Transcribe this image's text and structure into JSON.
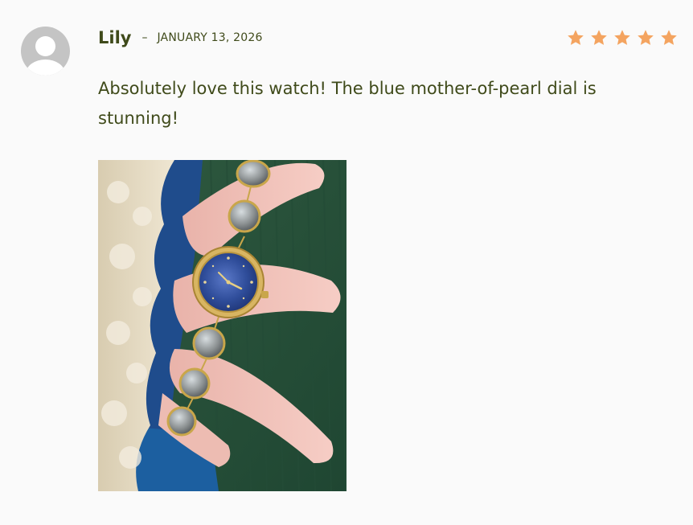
{
  "review": {
    "author": "Lily",
    "separator": "–",
    "date": "JANUARY 13, 2026",
    "rating": 5,
    "rating_max": 5,
    "text": "Absolutely love this watch! The blue mother-of-pearl dial is stunning!",
    "photo_alt": "Review photo"
  },
  "colors": {
    "text": "#3f4a1a",
    "star": "#f4a460",
    "background": "#fafafa",
    "avatar": "#c4c4c4"
  },
  "icons": {
    "avatar": "default-user-icon",
    "star": "star-icon"
  }
}
